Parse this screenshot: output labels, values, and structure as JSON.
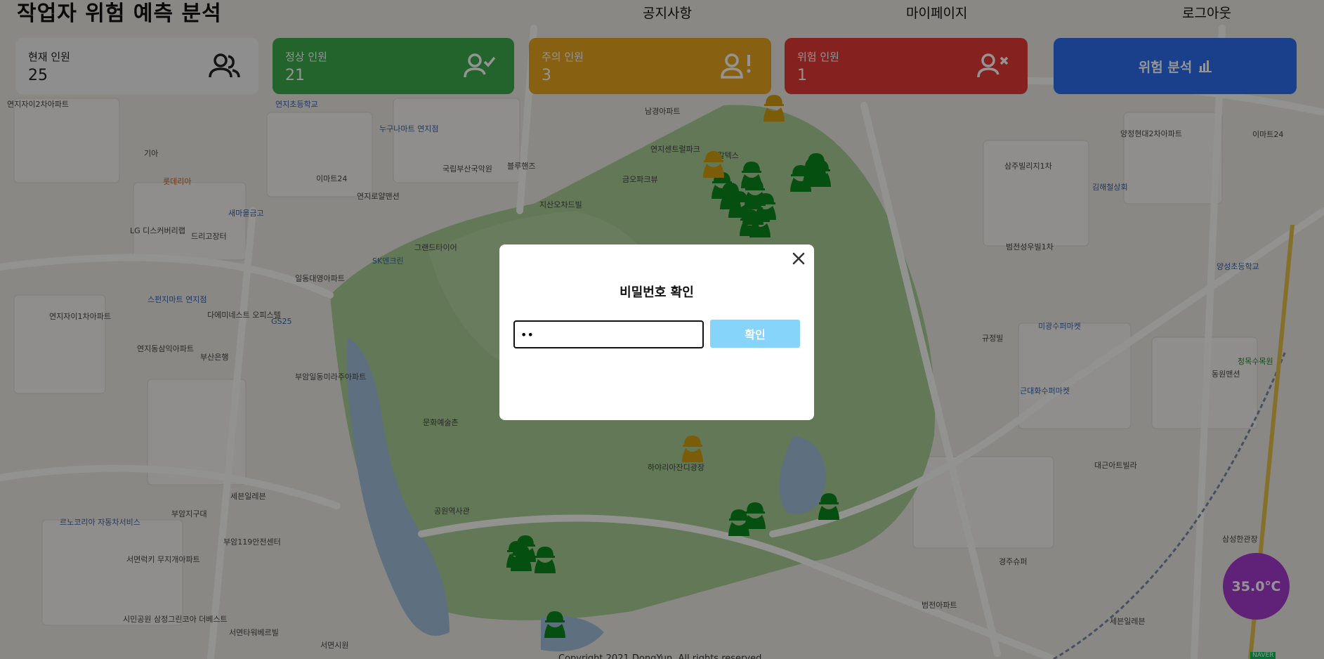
{
  "header": {
    "title": "작업자 위험 예측 분석",
    "nav": {
      "notice": "공지사항",
      "mypage": "마이페이지",
      "logout": "로그아웃"
    }
  },
  "stats": {
    "total": {
      "label": "현재 인원",
      "value": "25",
      "icon": "users-icon"
    },
    "normal": {
      "label": "정상 인원",
      "value": "21",
      "icon": "user-check-icon",
      "color": "#3cad4a"
    },
    "caution": {
      "label": "주의 인원",
      "value": "3",
      "icon": "user-alert-icon",
      "color": "#e9a620"
    },
    "danger": {
      "label": "위험 인원",
      "value": "1",
      "icon": "user-x-icon",
      "color": "#e53935"
    },
    "analysis": {
      "label": "위험 분석",
      "icon": "bar-chart-icon",
      "color": "#2f6ff0"
    }
  },
  "temperature": "35.0℃",
  "footer": "Copyright 2021 DongYun. All rights reserved.",
  "map": {
    "credit": "NAVER",
    "labels": [
      "연지자이2차아파트",
      "기아",
      "롯데리아",
      "LG 디스커버리랩",
      "새마을금고",
      "드리고장터",
      "연지초등학교",
      "누구나마트 연지점",
      "국립부산국악원",
      "블루핸즈",
      "이마트24",
      "연지로얄맨션",
      "남경아파트",
      "연지센트럴파크",
      "GS칼텍스",
      "금오파크뷰",
      "지산오차드빌",
      "그랜드타이어",
      "SK엔크린",
      "일동대영아파트",
      "스펀지마트 연지점",
      "다에미네스트 오피스텔",
      "연지자이1차아파트",
      "연지동삼익아파트",
      "부산은행",
      "GS25",
      "부암일동미라주아파트",
      "문화예술촌",
      "하야리아잔디광장",
      "공원역사관",
      "세븐일레븐",
      "부암지구대",
      "부암119안전센터",
      "르노코리아 자동차서비스",
      "서면럭키 무지개아파트",
      "시민공원 삼정그린코아 더베스트",
      "서면타워베르빌",
      "서면시원",
      "삼주빌리지1차",
      "범전성우빌1차",
      "미광수퍼마켓",
      "규정빌",
      "근대화수퍼마켓",
      "대근아트빌라",
      "경주슈퍼",
      "범전아파트",
      "양정현대2차아파트",
      "김해철상회",
      "양성초등학교",
      "동원맨션",
      "청목수목원",
      "삼성한관장",
      "이마트24",
      "세븐일레븐"
    ],
    "workers": {
      "normal": 21,
      "caution": 3,
      "danger": 1
    }
  },
  "modal": {
    "title": "비밀번호 확인",
    "password_value": "aa",
    "confirm_label": "확인",
    "close_icon": "close-icon"
  }
}
